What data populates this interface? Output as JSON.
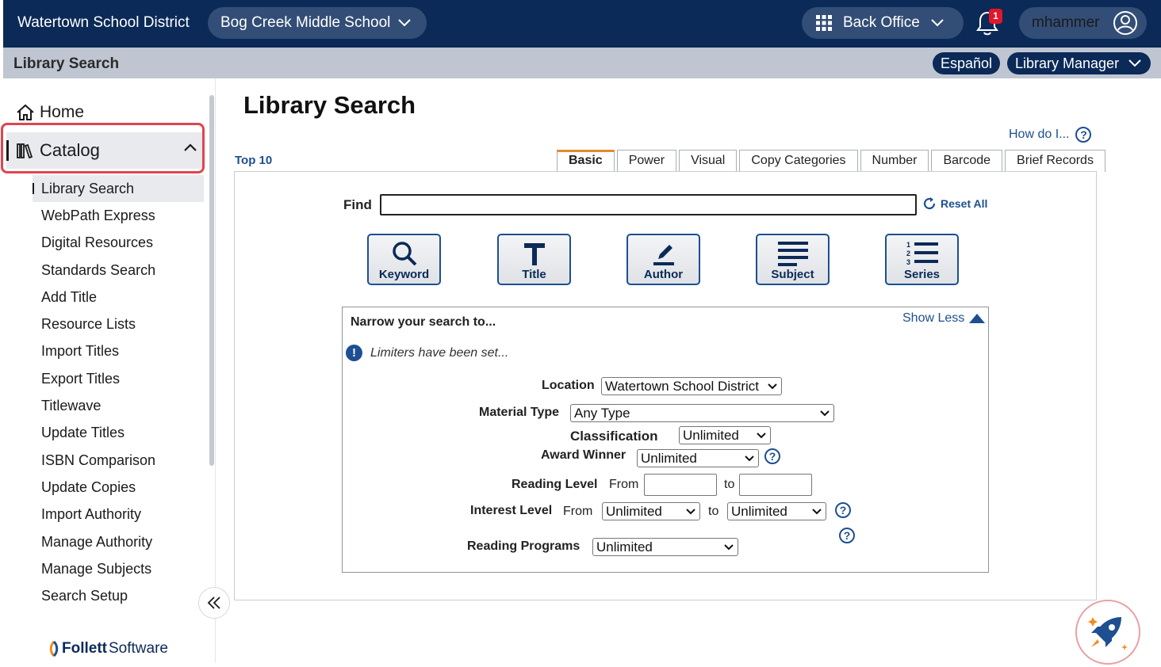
{
  "topbar": {
    "district": "Watertown School District",
    "school": "Bog Creek Middle School",
    "backoffice": "Back Office",
    "notification_count": "1",
    "user": "mhammer"
  },
  "subbar": {
    "title": "Library Search",
    "language": "Español",
    "role": "Library Manager"
  },
  "sidebar": {
    "home": "Home",
    "catalog": "Catalog",
    "items": [
      "Library Search",
      "WebPath Express",
      "Digital Resources",
      "Standards Search",
      "Add Title",
      "Resource Lists",
      "Import Titles",
      "Export Titles",
      "Titlewave",
      "Update Titles",
      "ISBN Comparison",
      "Update Copies",
      "Import Authority",
      "Manage Authority",
      "Manage Subjects",
      "Search Setup"
    ],
    "logo_brand": "Follett",
    "logo_suffix": "Software"
  },
  "main": {
    "title": "Library Search",
    "howdo": "How do I...",
    "top10": "Top 10",
    "tabs": [
      "Basic",
      "Power",
      "Visual",
      "Copy Categories",
      "Number",
      "Barcode",
      "Brief Records"
    ],
    "find_label": "Find",
    "find_value": "",
    "reset_all": "Reset All",
    "search_buttons": [
      "Keyword",
      "Title",
      "Author",
      "Subject",
      "Series"
    ]
  },
  "narrow": {
    "title": "Narrow your search to...",
    "show_less": "Show Less",
    "limiter_msg": "Limiters have been set...",
    "location_label": "Location",
    "location_value": "Watertown School District",
    "material_label": "Material Type",
    "material_value": "Any Type",
    "classification_label": "Classification",
    "classification_value": "Unlimited",
    "award_label": "Award Winner",
    "award_value": "Unlimited",
    "reading_level_label": "Reading Level",
    "from": "From",
    "to": "to",
    "interest_label": "Interest Level",
    "interest_from": "Unlimited",
    "interest_to": "Unlimited",
    "programs_label": "Reading Programs",
    "programs_value": "Unlimited"
  },
  "colors": {
    "navy": "#0b2a57",
    "pill": "#334e76",
    "link": "#1d4f91",
    "highlight": "#e0454f",
    "tab_accent": "#e28a2b"
  }
}
